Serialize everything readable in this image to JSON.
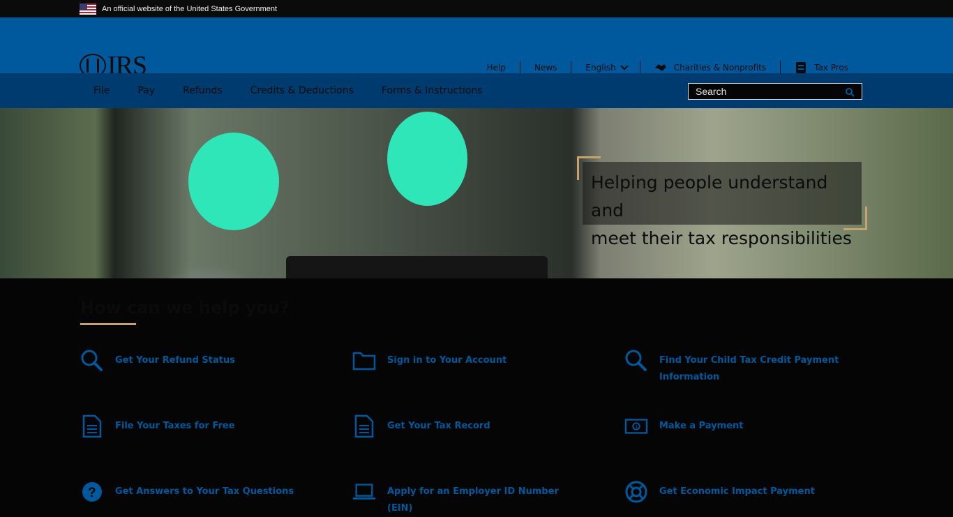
{
  "gov_banner": {
    "text": "An official website of the United States Government",
    "flag_icon": "us-flag-icon"
  },
  "header": {
    "logo_text": "IRS",
    "util_nav": [
      {
        "label": "Help"
      },
      {
        "label": "News"
      },
      {
        "label": "English"
      },
      {
        "label": "Charities & Nonprofits",
        "icon": "handshake-icon"
      },
      {
        "label": "Tax Pros",
        "icon": "document-icon"
      }
    ]
  },
  "main_nav": {
    "items": [
      {
        "label": "File"
      },
      {
        "label": "Pay"
      },
      {
        "label": "Refunds"
      },
      {
        "label": "Credits & Deductions"
      },
      {
        "label": "Forms & Instructions"
      }
    ],
    "search_placeholder": "Search"
  },
  "hero": {
    "line1": "Helping people understand and",
    "line2": "meet their tax responsibilities"
  },
  "help": {
    "title": "How can we help you?",
    "tasks": [
      {
        "label": "Get Your Refund Status",
        "icon": "search-icon"
      },
      {
        "label": "Sign in to Your Account",
        "icon": "folder-icon"
      },
      {
        "label": "Find Your Child Tax Credit Payment Information",
        "icon": "search-icon"
      },
      {
        "label": "File Your Taxes for Free",
        "icon": "document-icon"
      },
      {
        "label": "Get Your Tax Record",
        "icon": "document-icon"
      },
      {
        "label": "Make a Payment",
        "icon": "money-icon"
      },
      {
        "label": "Get Answers to Your Tax Questions",
        "icon": "question-icon"
      },
      {
        "label": "Apply for an Employer ID Number (EIN)",
        "icon": "laptop-icon"
      },
      {
        "label": "Get Economic Impact Payment",
        "icon": "lifebuoy-icon"
      }
    ]
  },
  "colors": {
    "primary": "#00599c",
    "nav": "#003b6f",
    "accent_gold": "#c4a36e"
  }
}
